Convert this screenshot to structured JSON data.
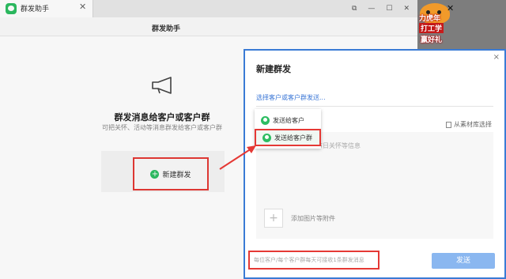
{
  "tab": {
    "title": "群发助手",
    "close_glyph": "✕"
  },
  "window_controls": [
    "⧉",
    "—",
    "☐",
    "✕"
  ],
  "header": {
    "title": "群发助手"
  },
  "main": {
    "heading": "群发消息给客户或客户群",
    "subtitle": "可把关怀、活动等消息群发给客户或客户群",
    "new_mass_label": "新建群发",
    "icon": "megaphone-icon"
  },
  "promo": {
    "line1": "力虎年",
    "line2": "打工学",
    "line3": "赢好礼",
    "close_glyph": "✕"
  },
  "dialog": {
    "title": "新建群发",
    "close_glyph": "×",
    "select_link": "选择客户或客户群发送...",
    "library_pick": "从素材库选择",
    "message_placeholder": "节日关怀等信息",
    "add_attachment_label": "添加图片等附件",
    "add_glyph": "+",
    "footer_note": "每位客户/每个客户群每天可接收1条群发消息",
    "send_label": "发送"
  },
  "dropdown": {
    "items": [
      {
        "label": "发送给客户",
        "icon": "person-icon"
      },
      {
        "label": "发送给客户群",
        "icon": "group-icon"
      }
    ]
  },
  "colors": {
    "accent_green": "#2dbd62",
    "link_blue": "#3a76d6",
    "highlight_red": "#e53935",
    "send_disabled": "#8ab7f0"
  }
}
